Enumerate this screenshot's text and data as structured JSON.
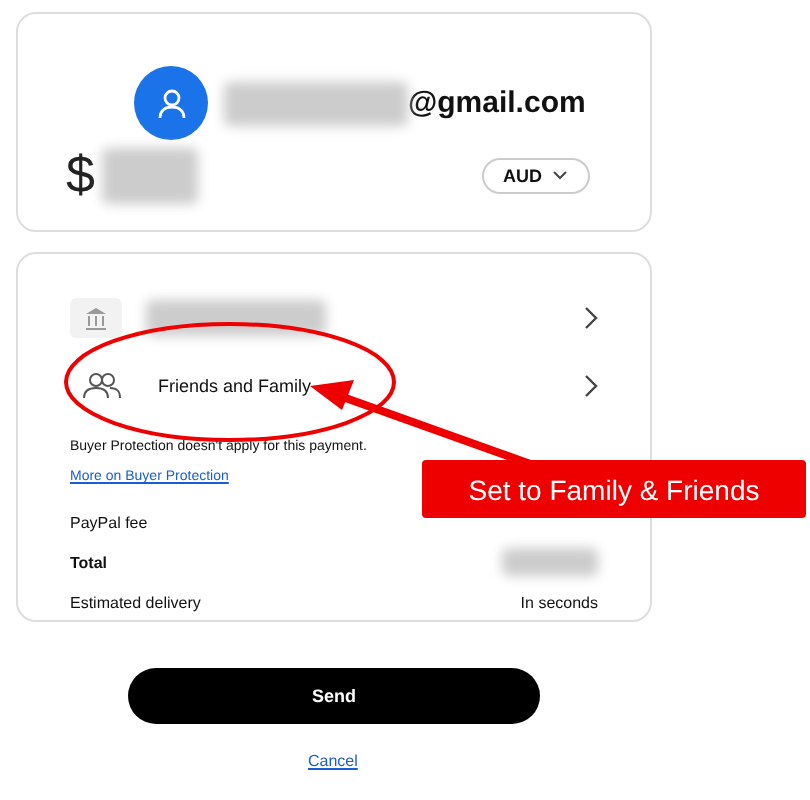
{
  "recipient": {
    "email_suffix": "@gmail.com",
    "currency_symbol": "$",
    "currency": "AUD"
  },
  "payment": {
    "rows": [
      {
        "kind": "bank"
      },
      {
        "kind": "friends",
        "label": "Friends and Family"
      }
    ],
    "notice": "Buyer Protection doesn't apply for this payment.",
    "notice_link": "More on Buyer Protection",
    "details": [
      {
        "label": "PayPal fee",
        "bold": false
      },
      {
        "label": "Total",
        "bold": true,
        "value_redacted": true
      },
      {
        "label": "Estimated delivery",
        "value": "In seconds",
        "bold": false
      }
    ]
  },
  "send_button": "Send",
  "cancel_link": "Cancel",
  "annotation": {
    "callout": "Set to Family & Friends"
  }
}
